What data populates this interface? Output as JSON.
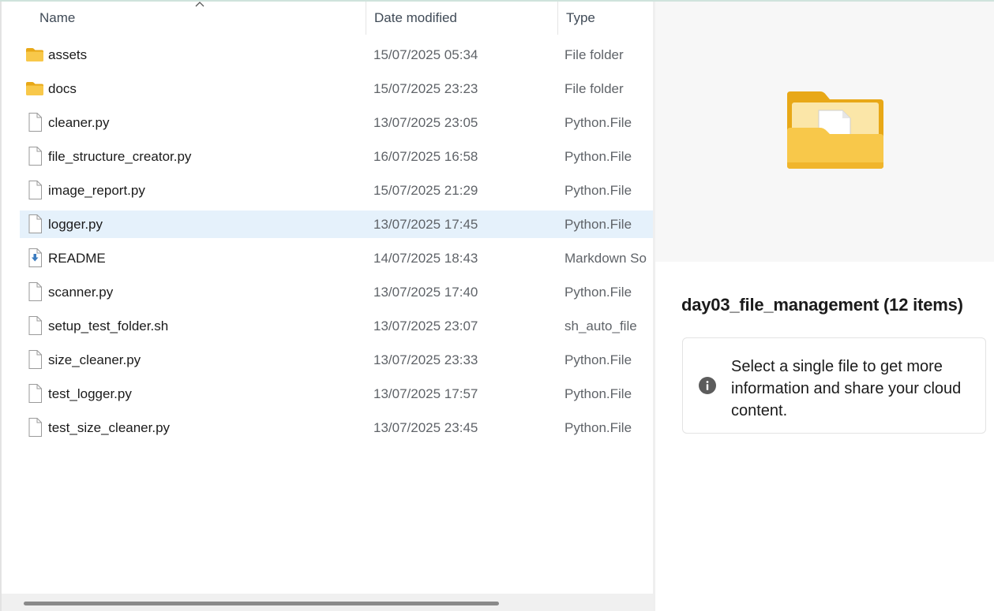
{
  "columns": {
    "name": "Name",
    "date_modified": "Date modified",
    "type": "Type"
  },
  "files": [
    {
      "name": "assets",
      "date": "15/07/2025 05:34",
      "type": "File folder",
      "icon": "folder-icon",
      "selected": false
    },
    {
      "name": "docs",
      "date": "15/07/2025 23:23",
      "type": "File folder",
      "icon": "folder-icon",
      "selected": false
    },
    {
      "name": "cleaner.py",
      "date": "13/07/2025 23:05",
      "type": "Python.File",
      "icon": "file-icon",
      "selected": false
    },
    {
      "name": "file_structure_creator.py",
      "date": "16/07/2025 16:58",
      "type": "Python.File",
      "icon": "file-icon",
      "selected": false
    },
    {
      "name": "image_report.py",
      "date": "15/07/2025 21:29",
      "type": "Python.File",
      "icon": "file-icon",
      "selected": false
    },
    {
      "name": "logger.py",
      "date": "13/07/2025 17:45",
      "type": "Python.File",
      "icon": "file-icon",
      "selected": true
    },
    {
      "name": "README",
      "date": "14/07/2025 18:43",
      "type": "Markdown So",
      "icon": "markdown-file-icon",
      "selected": false
    },
    {
      "name": "scanner.py",
      "date": "13/07/2025 17:40",
      "type": "Python.File",
      "icon": "file-icon",
      "selected": false
    },
    {
      "name": "setup_test_folder.sh",
      "date": "13/07/2025 23:07",
      "type": "sh_auto_file",
      "icon": "file-icon",
      "selected": false
    },
    {
      "name": "size_cleaner.py",
      "date": "13/07/2025 23:33",
      "type": "Python.File",
      "icon": "file-icon",
      "selected": false
    },
    {
      "name": "test_logger.py",
      "date": "13/07/2025 17:57",
      "type": "Python.File",
      "icon": "file-icon",
      "selected": false
    },
    {
      "name": "test_size_cleaner.py",
      "date": "13/07/2025 23:45",
      "type": "Python.File",
      "icon": "file-icon",
      "selected": false
    }
  ],
  "details": {
    "title": "day03_file_management (12 items)",
    "info_text": "Select a single file to get more information and share your cloud content.",
    "preview_icon": "folder-with-document-icon"
  },
  "colors": {
    "selection": "#e5f1fb",
    "folder": "#f5c242",
    "accent": "#0067c0"
  }
}
